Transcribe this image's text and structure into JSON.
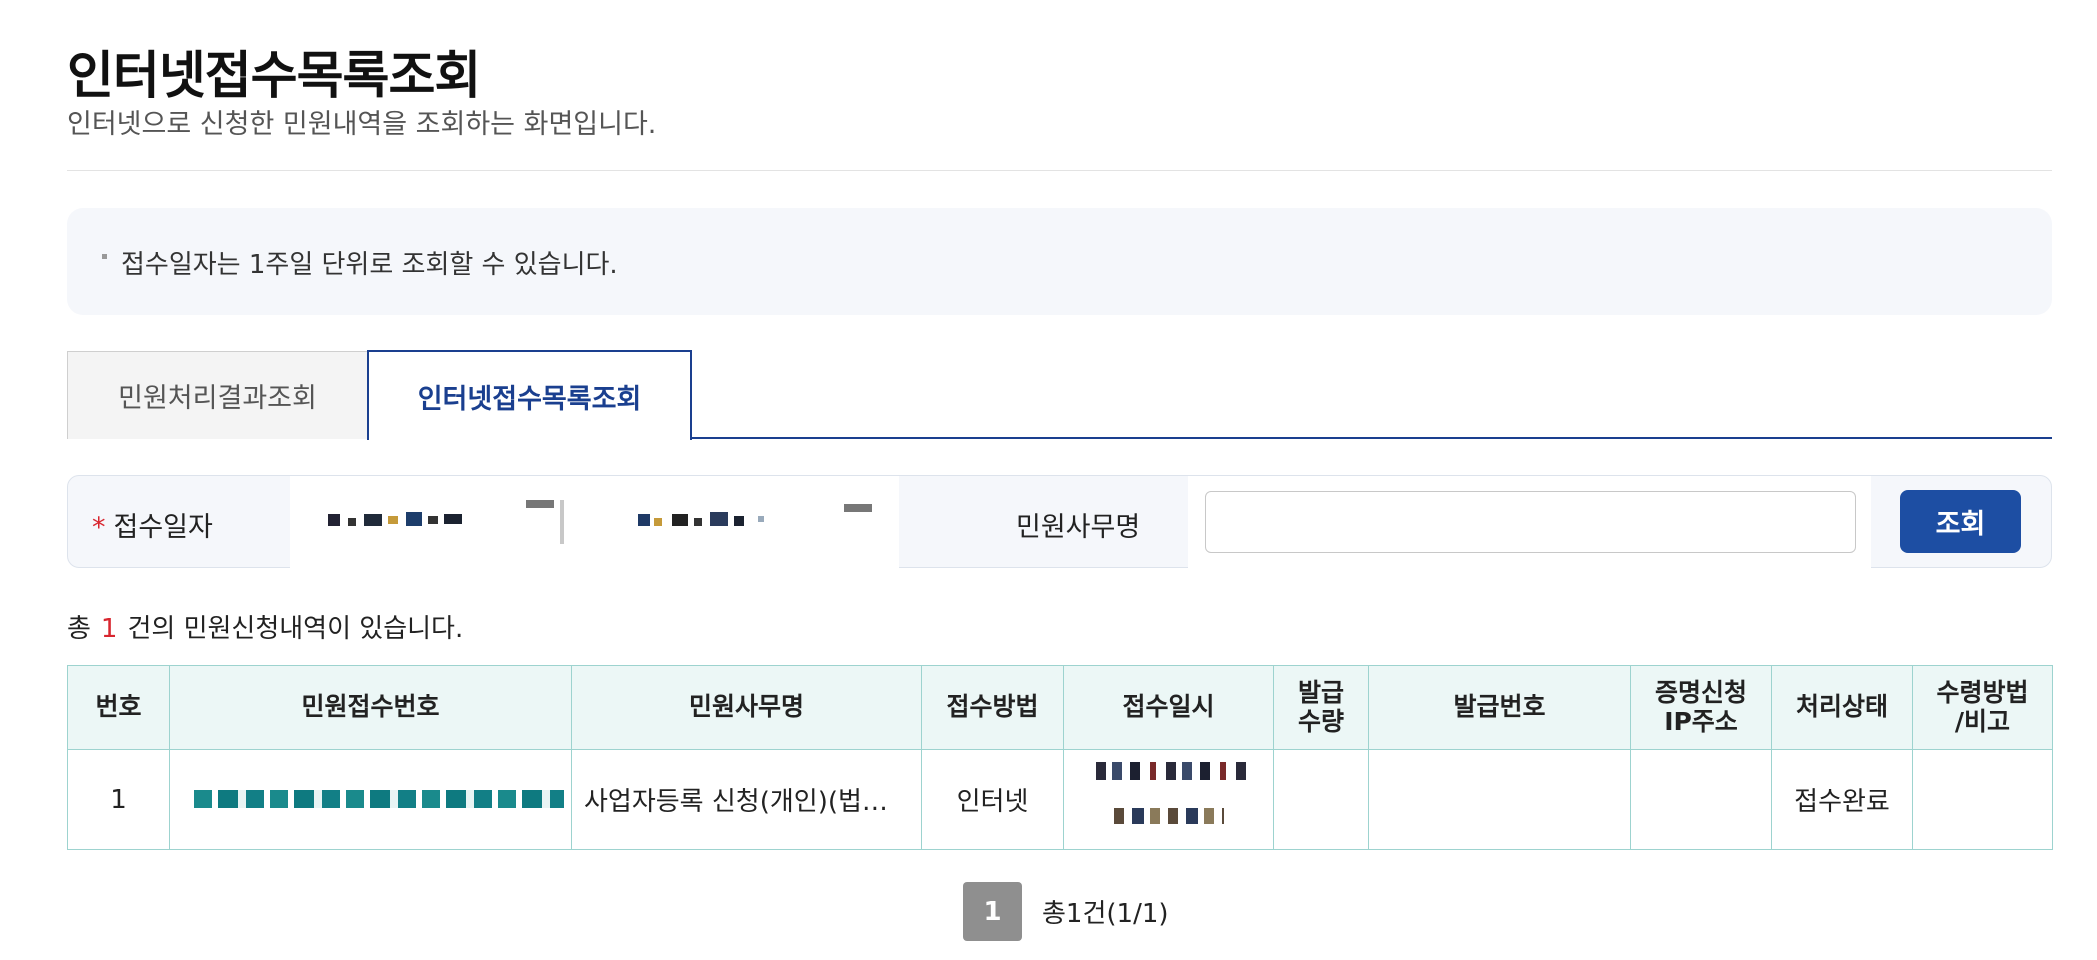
{
  "header": {
    "title": "인터넷접수목록조회",
    "description": "인터넷으로 신청한 민원내역을 조회하는 화면입니다."
  },
  "notice": {
    "text": "접수일자는 1주일 단위로 조회할 수 있습니다."
  },
  "tabs": [
    {
      "label": "민원처리결과조회",
      "active": false
    },
    {
      "label": "인터넷접수목록조회",
      "active": true
    }
  ],
  "search": {
    "required_mark": "*",
    "date_label": "접수일자",
    "office_label": "민원사무명",
    "office_value": "",
    "button_label": "조회"
  },
  "result_count": {
    "prefix": "총",
    "count": "1",
    "suffix": "건의 민원신청내역이 있습니다."
  },
  "table": {
    "headers": [
      "번호",
      "민원접수번호",
      "민원사무명",
      "접수방법",
      "접수일시",
      "발급\n수량",
      "발급번호",
      "증명신청\nIP주소",
      "처리상태",
      "수령방법\n/비고"
    ],
    "rows": [
      {
        "no": "1",
        "receipt_no": "",
        "office_name": "사업자등록 신청(개인)(법…",
        "method": "인터넷",
        "datetime": "",
        "issue_qty": "",
        "issue_no": "",
        "ip": "",
        "status": "접수완료",
        "receive_method": ""
      }
    ]
  },
  "pagination": {
    "current": "1",
    "summary": "총1건(1/1)"
  },
  "colors": {
    "primary": "#1d4ea3",
    "tab_active": "#1a3f8f",
    "required": "#d8262f",
    "table_header_bg": "#ecf7f6",
    "table_border": "#9dd3cf"
  }
}
